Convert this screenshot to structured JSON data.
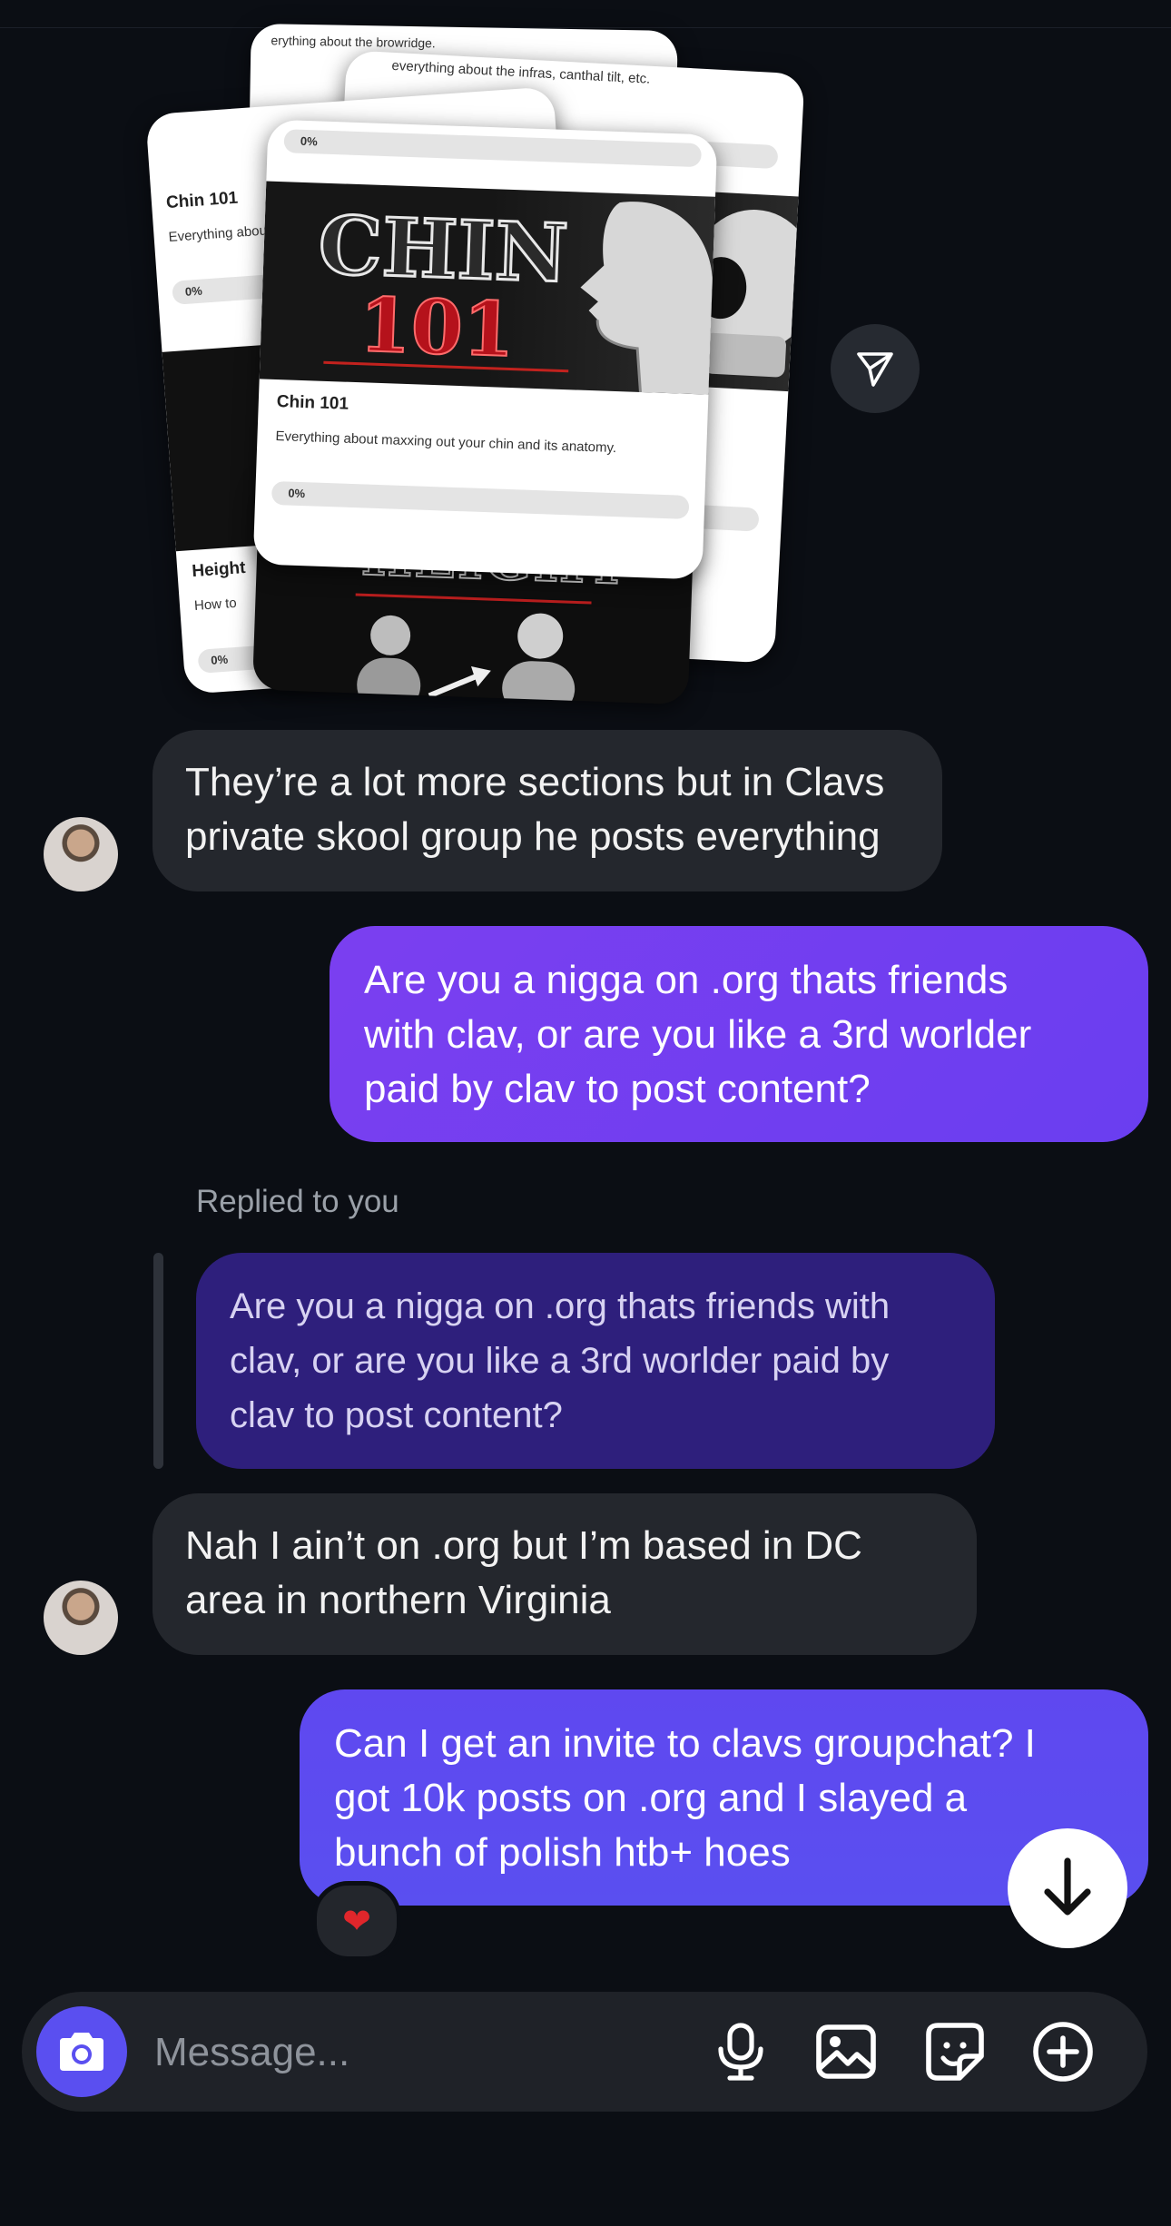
{
  "cards": {
    "back_top": {
      "desc_a": "erything about the browridge.",
      "desc_b": "everything about the infras, canthal tilt, etc.",
      "pct": "0%"
    },
    "left": {
      "title": "Chin 101",
      "desc": "Everything abou",
      "pct": "0%"
    },
    "left_bottom": {
      "title": "Height",
      "desc": "How to",
      "pct": "0%"
    },
    "front": {
      "image_text_line1": "CHIN",
      "image_text_line2": "101",
      "title": "Chin 101",
      "desc": "Everything about maxxing out your chin and its anatomy.",
      "pct": "0%"
    },
    "bottom_image_text": "HEIGHT"
  },
  "messages": [
    {
      "side": "in",
      "text_lines": [
        "They’re a lot more sections but in Clavs",
        "private skool group he posts everything"
      ]
    },
    {
      "side": "out",
      "text_lines": [
        "Are you a nigga on .org thats friends",
        "with clav, or are you like a 3rd worlder",
        "paid by clav to post content?"
      ]
    },
    {
      "reply_label": "Replied to you",
      "quote_lines": [
        "Are you a nigga on .org thats friends with",
        "clav, or are you like a 3rd worlder paid by",
        "clav to post content?"
      ]
    },
    {
      "side": "in",
      "text_lines": [
        "Nah I ain’t on .org but I’m based in DC",
        "area in northern Virginia"
      ]
    },
    {
      "side": "out",
      "text_lines": [
        "Can I get an invite to clavs groupchat? I",
        "got 10k posts on .org and I slayed a",
        "bunch of polish htb+ hoes"
      ],
      "reaction": "❤"
    }
  ],
  "composer": {
    "placeholder": "Message..."
  },
  "colors": {
    "background": "#0b0e14",
    "incoming": "#24272d",
    "outgoing_top": "#7b3ff0",
    "outgoing_bottom": "#5a4ff0",
    "reply_quote": "#2e1f7c"
  },
  "icons": [
    "send-icon",
    "arrow-down-icon",
    "camera-icon",
    "microphone-icon",
    "image-icon",
    "sticker-icon",
    "plus-icon"
  ]
}
